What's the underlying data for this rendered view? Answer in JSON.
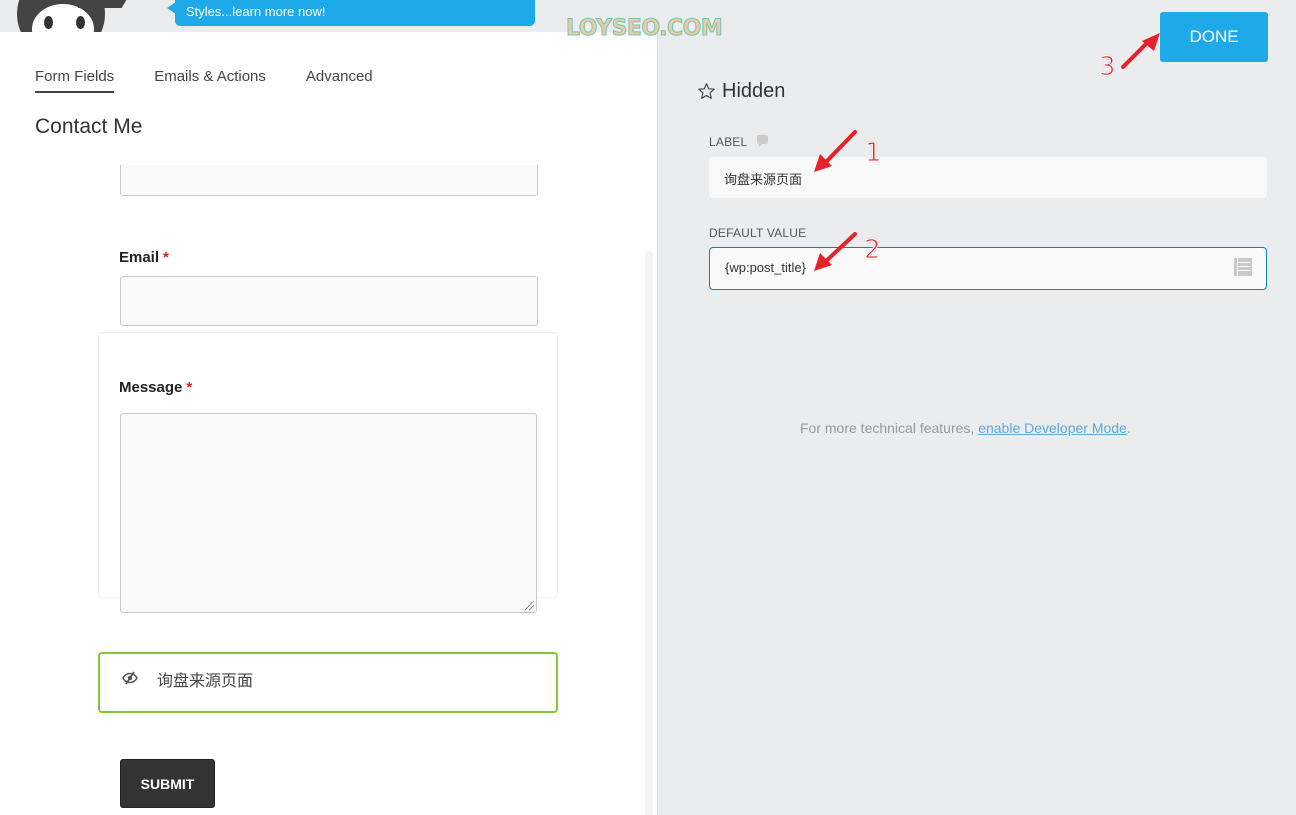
{
  "header": {
    "promo_text": "Styles...learn more now!",
    "watermark": "LOYSEO.COM"
  },
  "left_panel": {
    "tabs": [
      {
        "label": "Form Fields",
        "active": true
      },
      {
        "label": "Emails & Actions",
        "active": false
      },
      {
        "label": "Advanced",
        "active": false
      }
    ],
    "form_title": "Contact Me",
    "fields": {
      "email": {
        "label": "Email",
        "required_mark": "*",
        "value": ""
      },
      "message": {
        "label": "Message",
        "required_mark": "*",
        "value": ""
      },
      "hidden": {
        "label": "询盘来源页面",
        "icon": "eye-slash-icon"
      }
    },
    "submit_label": "SUBMIT"
  },
  "right_panel": {
    "done_label": "DONE",
    "field_type_title": "Hidden",
    "field_type_icon": "star-icon",
    "label_field": {
      "label": "LABEL",
      "value": "询盘来源页面"
    },
    "default_value_field": {
      "label": "DEFAULT VALUE",
      "value": "{wp:post_title}",
      "icon": "merge-tags-icon"
    },
    "developer_note": {
      "prefix": "For more technical features, ",
      "link_text": "enable Developer Mode",
      "suffix": "."
    }
  },
  "annotations": [
    {
      "number": "1",
      "color": "#e8202a"
    },
    {
      "number": "2",
      "color": "#e8202a"
    },
    {
      "number": "3",
      "color": "#e8202a"
    }
  ],
  "colors": {
    "accent_blue": "#1ea9e9",
    "hidden_field_border": "#86c731",
    "focus_border": "#0f7fbf",
    "required": "#e01b24"
  }
}
